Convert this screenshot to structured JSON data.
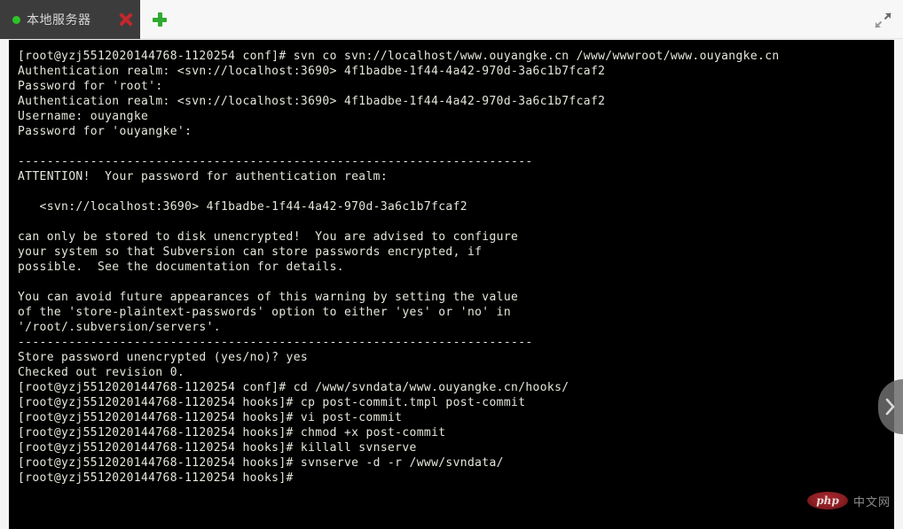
{
  "window": {
    "expand_icon": "expand-diagonal-icon"
  },
  "tabbar": {
    "tabs": [
      {
        "label": "本地服务器",
        "status_dot": "green-status-dot",
        "close_icon": "close-x-icon"
      }
    ],
    "add_tab_icon": "plus-icon"
  },
  "edge_nav": {
    "icon": "chevron-right-icon"
  },
  "watermark": {
    "badge": "php",
    "text": "中文网"
  },
  "terminal": {
    "prompt_host": "[root@yzj5512020144768-1120254",
    "lines": [
      "[root@yzj5512020144768-1120254 conf]# svn co svn://localhost/www.ouyangke.cn /www/wwwroot/www.ouyangke.cn",
      "Authentication realm: <svn://localhost:3690> 4f1badbe-1f44-4a42-970d-3a6c1b7fcaf2",
      "Password for 'root':",
      "Authentication realm: <svn://localhost:3690> 4f1badbe-1f44-4a42-970d-3a6c1b7fcaf2",
      "Username: ouyangke",
      "Password for 'ouyangke':",
      "",
      "-----------------------------------------------------------------------",
      "ATTENTION!  Your password for authentication realm:",
      "",
      "   <svn://localhost:3690> 4f1badbe-1f44-4a42-970d-3a6c1b7fcaf2",
      "",
      "can only be stored to disk unencrypted!  You are advised to configure",
      "your system so that Subversion can store passwords encrypted, if",
      "possible.  See the documentation for details.",
      "",
      "You can avoid future appearances of this warning by setting the value",
      "of the 'store-plaintext-passwords' option to either 'yes' or 'no' in",
      "'/root/.subversion/servers'.",
      "-----------------------------------------------------------------------",
      "Store password unencrypted (yes/no)? yes",
      "Checked out revision 0.",
      "[root@yzj5512020144768-1120254 conf]# cd /www/svndata/www.ouyangke.cn/hooks/",
      "[root@yzj5512020144768-1120254 hooks]# cp post-commit.tmpl post-commit",
      "[root@yzj5512020144768-1120254 hooks]# vi post-commit",
      "[root@yzj5512020144768-1120254 hooks]# chmod +x post-commit",
      "[root@yzj5512020144768-1120254 hooks]# killall svnserve",
      "[root@yzj5512020144768-1120254 hooks]# svnserve -d -r /www/svndata/",
      "[root@yzj5512020144768-1120254 hooks]#"
    ]
  }
}
